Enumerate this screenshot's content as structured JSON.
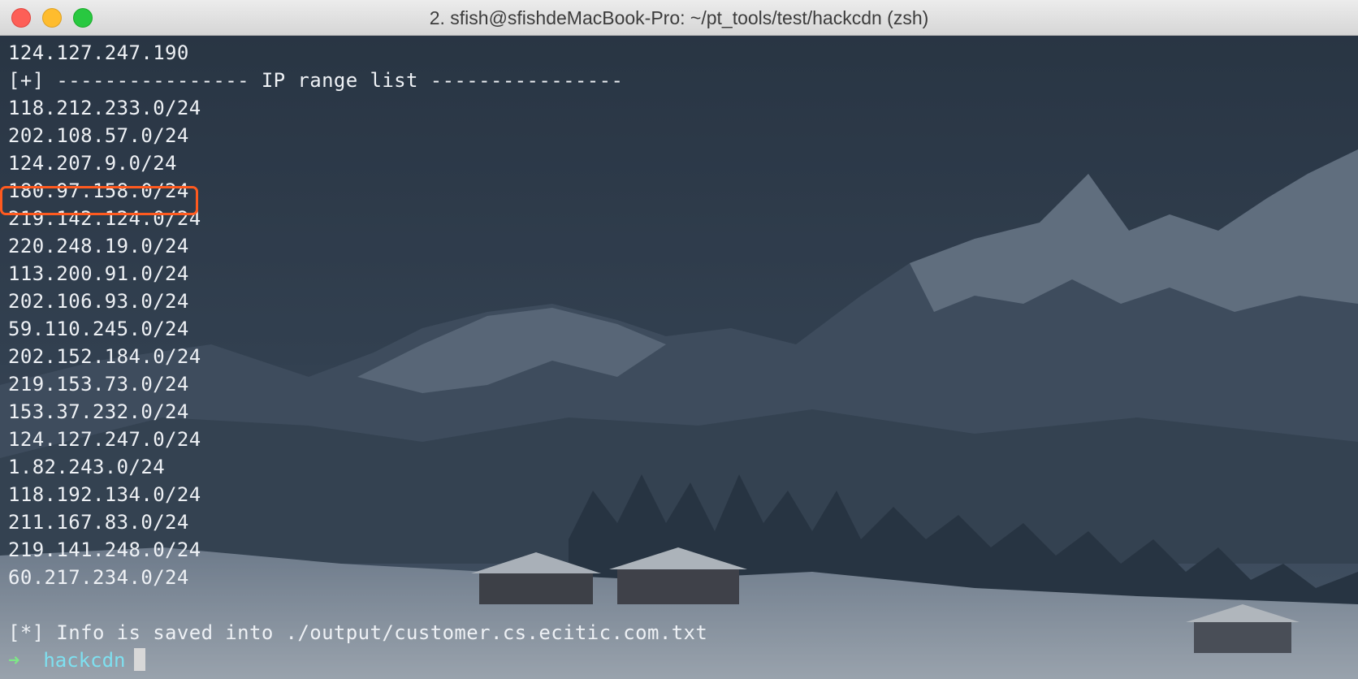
{
  "window": {
    "title": "2. sfish@sfishdeMacBook-Pro: ~/pt_tools/test/hackcdn (zsh)"
  },
  "terminal": {
    "lines": [
      "124.127.247.190",
      "[+] ---------------- IP range list ----------------",
      "118.212.233.0/24",
      "202.108.57.0/24",
      "124.207.9.0/24",
      "180.97.158.0/24",
      "219.142.124.0/24",
      "220.248.19.0/24",
      "113.200.91.0/24",
      "202.106.93.0/24",
      "59.110.245.0/24",
      "202.152.184.0/24",
      "219.153.73.0/24",
      "153.37.232.0/24",
      "124.127.247.0/24",
      "1.82.243.0/24",
      "118.192.134.0/24",
      "211.167.83.0/24",
      "219.141.248.0/24",
      "60.217.234.0/24",
      "",
      "[*] Info is saved into ./output/customer.cs.ecitic.com.txt"
    ],
    "prompt": {
      "arrow": "➜",
      "directory": "hackcdn"
    }
  },
  "colors": {
    "highlight_box": "#ff5a1f",
    "prompt_arrow": "#7ee787",
    "prompt_dir": "#7ee0f0"
  }
}
